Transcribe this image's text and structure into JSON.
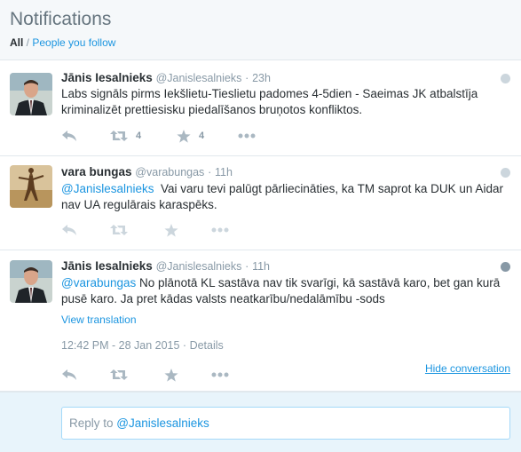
{
  "header": {
    "title": "Notifications",
    "filter_all": "All",
    "filter_separator": " / ",
    "filter_follow": "People you follow"
  },
  "tweets": [
    {
      "name": "Jānis Iesalnieks",
      "handle": "@Janislesalnieks",
      "dot": "·",
      "time": "23h",
      "text": "Labs signāls pirms Iekšlietu-Tieslietu padomes 4-5dien - Saeimas JK atbalstīja kriminalizēt prettiesisku piedalīšanos bruņotos konfliktos.",
      "retweets": "4",
      "favorites": "4"
    },
    {
      "name": "vara bungas",
      "handle": "@varabungas",
      "dot": "·",
      "time": "11h",
      "mention": "@Janislesalnieks",
      "text": "Vai varu tevi palūgt pārliecināties, ka TM saprot ka DUK un Aidar nav UA regulārais karaspēks."
    },
    {
      "name": "Jānis Iesalnieks",
      "handle": "@Janislesalnieks",
      "dot": "·",
      "time": "11h",
      "mention": "@varabungas",
      "text": "No plānotā KL sastāva nav tik svarīgi, kā sastāvā karo, bet gan kurā pusē karo. Ja pret kādas valsts neatkarību/nedalāmību -sods",
      "view_translation": "View translation",
      "timestamp": "12:42 PM - 28 Jan 2015",
      "details_sep": "·",
      "details": "Details",
      "hide_conversation": "Hide conversation"
    }
  ],
  "reply": {
    "prefix": "Reply to ",
    "handle": "@Janislesalnieks"
  },
  "colors": {
    "link": "#1b95e0",
    "muted": "#8899a6",
    "icon": "#aab8c2",
    "header_bg": "#f5f8fa",
    "reply_bg": "#e8f4fb"
  },
  "icons": [
    "globe-icon",
    "reply-icon",
    "retweet-icon",
    "favorite-icon",
    "more-icon"
  ]
}
